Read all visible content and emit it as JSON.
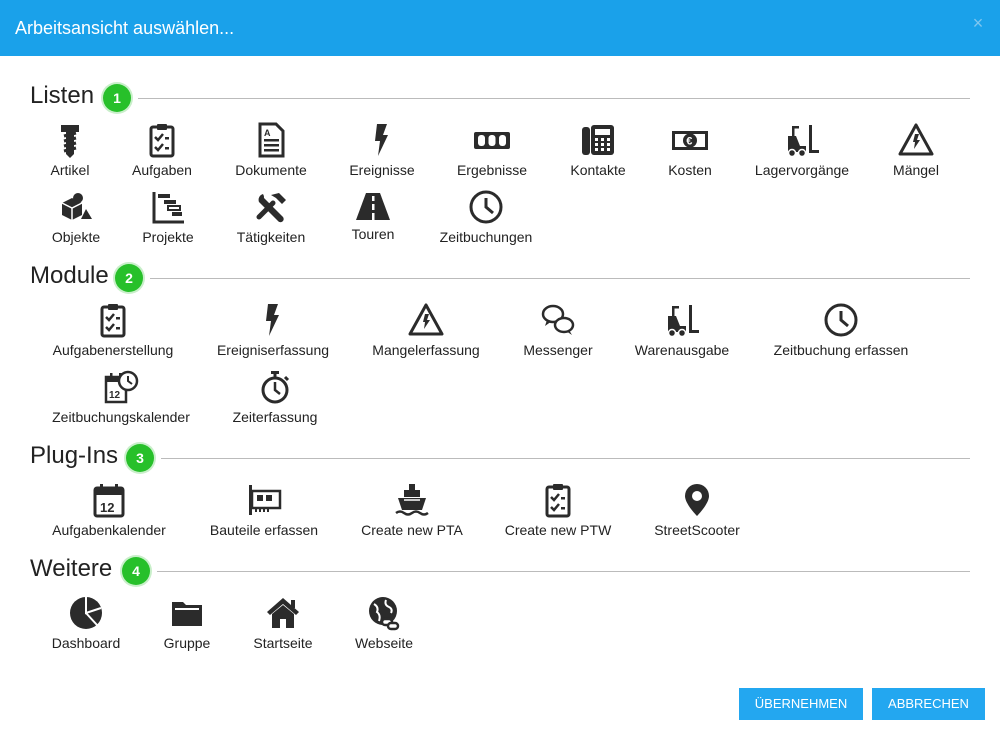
{
  "dialog": {
    "title": "Arbeitsansicht auswählen...",
    "close_glyph": "×"
  },
  "sections": [
    {
      "name": "Listen",
      "badge": "1",
      "items": [
        {
          "label": "Artikel",
          "icon": "screw-icon"
        },
        {
          "label": "Aufgaben",
          "icon": "clipboard-check-icon"
        },
        {
          "label": "Dokumente",
          "icon": "document-icon"
        },
        {
          "label": "Ereignisse",
          "icon": "lightning-icon"
        },
        {
          "label": "Ergebnisse",
          "icon": "counter-icon"
        },
        {
          "label": "Kontakte",
          "icon": "phone-icon"
        },
        {
          "label": "Kosten",
          "icon": "euro-banknote-icon"
        },
        {
          "label": "Lagervorgänge",
          "icon": "forklift-icon"
        },
        {
          "label": "Mängel",
          "icon": "warning-icon"
        },
        {
          "label": "Objekte",
          "icon": "objects-icon"
        },
        {
          "label": "Projekte",
          "icon": "gantt-icon"
        },
        {
          "label": "Tätigkeiten",
          "icon": "tools-icon"
        },
        {
          "label": "Touren",
          "icon": "road-icon"
        },
        {
          "label": "Zeitbuchungen",
          "icon": "clock-icon"
        }
      ]
    },
    {
      "name": "Module",
      "badge": "2",
      "items": [
        {
          "label": "Aufgabenerstellung",
          "icon": "clipboard-check-icon"
        },
        {
          "label": "Ereigniserfassung",
          "icon": "lightning-icon"
        },
        {
          "label": "Mangelerfassung",
          "icon": "warning-icon"
        },
        {
          "label": "Messenger",
          "icon": "chat-icon"
        },
        {
          "label": "Warenausgabe",
          "icon": "forklift-icon"
        },
        {
          "label": "Zeitbuchung erfassen",
          "icon": "clock-icon"
        },
        {
          "label": "Zeitbuchungskalender",
          "icon": "calendar-clock-icon"
        },
        {
          "label": "Zeiterfassung",
          "icon": "stopwatch-icon"
        }
      ]
    },
    {
      "name": "Plug-Ins",
      "badge": "3",
      "items": [
        {
          "label": "Aufgabenkalender",
          "icon": "calendar-icon"
        },
        {
          "label": "Bauteile erfassen",
          "icon": "circuit-card-icon"
        },
        {
          "label": "Create new PTA",
          "icon": "ship-icon"
        },
        {
          "label": "Create new PTW",
          "icon": "clipboard-check-icon"
        },
        {
          "label": "StreetScooter",
          "icon": "map-pin-icon"
        }
      ]
    },
    {
      "name": "Weitere",
      "badge": "4",
      "items": [
        {
          "label": "Dashboard",
          "icon": "pie-chart-icon"
        },
        {
          "label": "Gruppe",
          "icon": "folder-icon"
        },
        {
          "label": "Startseite",
          "icon": "home-icon"
        },
        {
          "label": "Webseite",
          "icon": "globe-link-icon"
        }
      ]
    }
  ],
  "buttons": {
    "accept": "ÜBERNEHMEN",
    "cancel": "ABBRECHEN"
  },
  "colors": {
    "header": "#1aa1ea",
    "badge": "#27c02a",
    "button": "#23a7f0"
  }
}
